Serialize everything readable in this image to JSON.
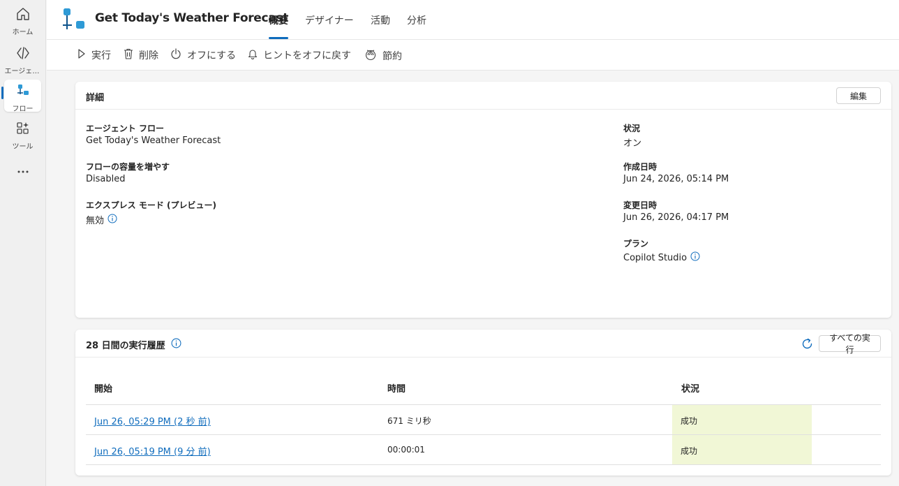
{
  "nav": {
    "items": [
      {
        "label": "ホーム",
        "icon": "home-icon"
      },
      {
        "label": "エージェント",
        "icon": "agent-icon"
      },
      {
        "label": "フロー",
        "icon": "flow-icon"
      },
      {
        "label": "ツール",
        "icon": "tools-icon"
      }
    ]
  },
  "header": {
    "title": "Get Today's Weather Forecast",
    "tabs": [
      "概要",
      "デザイナー",
      "活動",
      "分析"
    ]
  },
  "commands": {
    "run": "実行",
    "delete": "削除",
    "turn_off": "オフにする",
    "hints_off": "ヒントをオフに戻す",
    "save": "節約"
  },
  "details": {
    "title": "詳細",
    "edit_button": "編集",
    "fields": {
      "agent_flow_label": "エージェント フロー",
      "agent_flow_value": "Get Today's Weather Forecast",
      "capacity_label": "フローの容量を増やす",
      "capacity_value": "Disabled",
      "express_label": "エクスプレス モード (プレビュー)",
      "express_value": "無効",
      "status_label": "状況",
      "status_value": "オン",
      "created_label": "作成日時",
      "created_value": "Jun 24, 2026, 05:14 PM",
      "modified_label": "変更日時",
      "modified_value": "Jun 26, 2026, 04:17 PM",
      "plan_label": "プラン",
      "plan_value": "Copilot Studio"
    }
  },
  "history": {
    "title": "28 日間の実行履歴",
    "all_runs_button": "すべての実行",
    "columns": [
      "開始",
      "時間",
      "状況"
    ],
    "rows": [
      {
        "start": "Jun 26, 05:29 PM (2 秒 前)",
        "duration": "671 ミリ秒",
        "status": "成功"
      },
      {
        "start": "Jun 26, 05:19 PM (9 分 前)",
        "duration": "00:00:01",
        "status": "成功"
      }
    ]
  },
  "colors": {
    "accent": "#0f6cbd",
    "success_bg": "#f1f7d6"
  }
}
